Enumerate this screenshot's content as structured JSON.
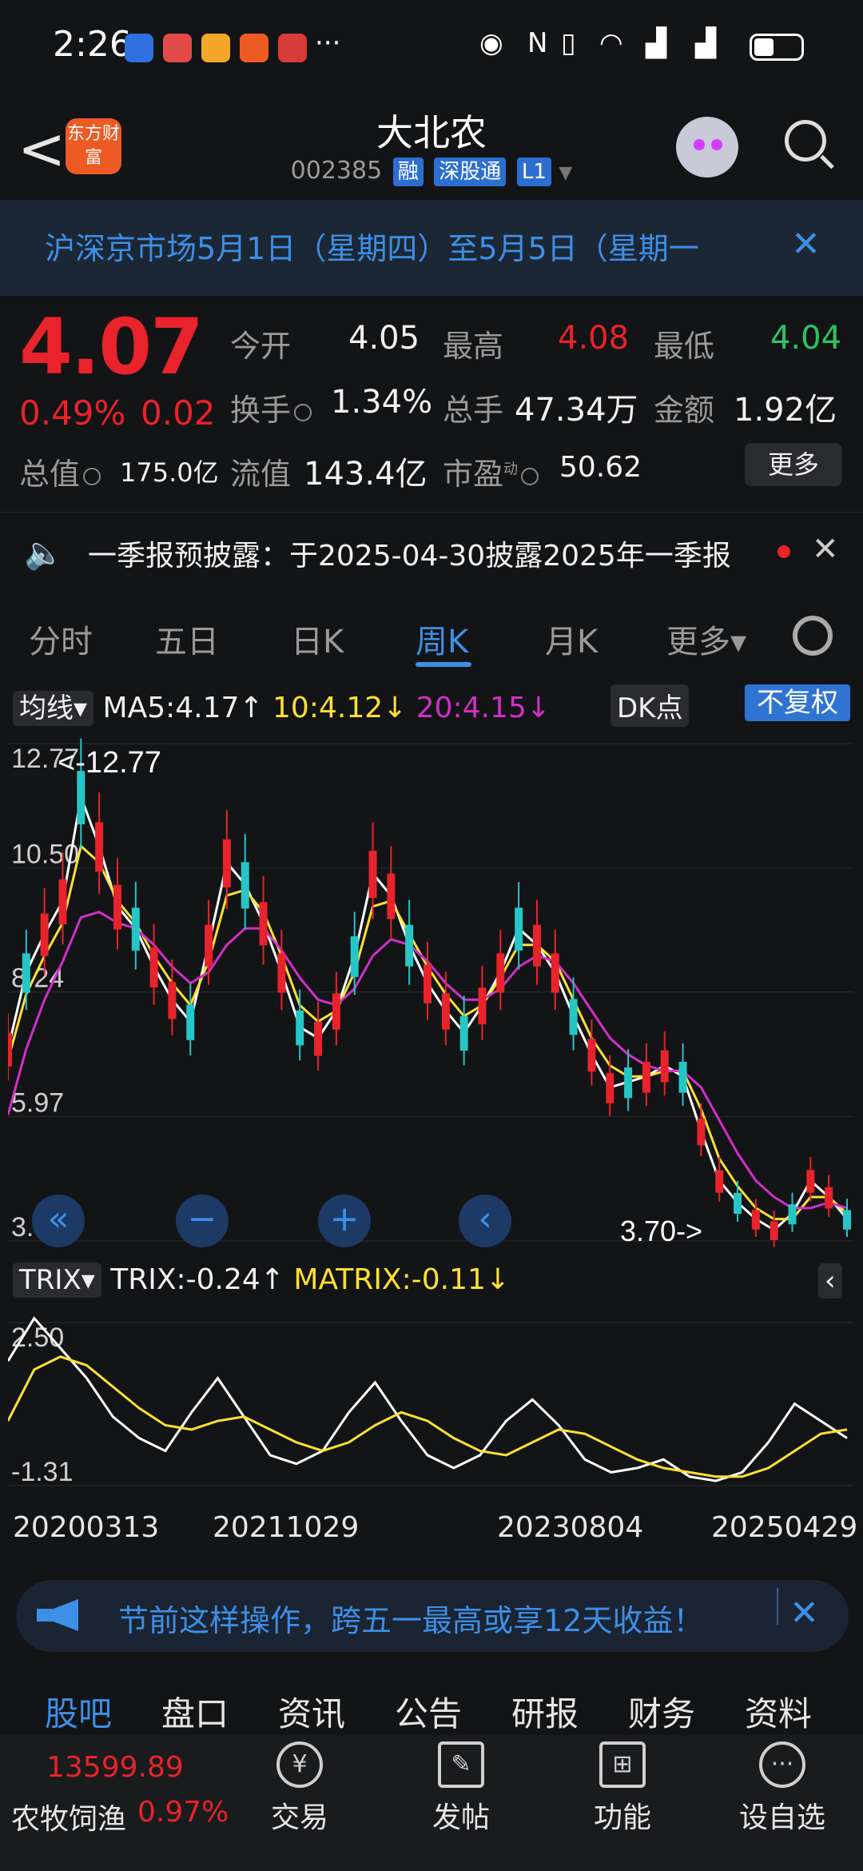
{
  "status_bar": {
    "time": "2:26",
    "dots": "···"
  },
  "header": {
    "back": "<",
    "logo_text": "东方财富",
    "title": "大北农",
    "code": "002385",
    "tags": [
      "融",
      "深股通",
      "L1"
    ]
  },
  "notice": {
    "text": "沪深京市场5月1日（星期四）至5月5日（星期一",
    "close": "✕"
  },
  "quote": {
    "price": "4.07",
    "change_pct": "0.49%",
    "change_amt": "0.02",
    "rows": [
      [
        {
          "label": "今开",
          "value": "4.05",
          "color": "#f1f1f1"
        },
        {
          "label": "最高",
          "value": "4.08",
          "color": "#e8232b"
        },
        {
          "label": "最低",
          "value": "4.04",
          "color": "#2bc465"
        }
      ],
      [
        {
          "label": "换手",
          "value": "1.34%",
          "color": "#f1f1f1"
        },
        {
          "label": "总手",
          "value": "47.34万",
          "color": "#f1f1f1"
        },
        {
          "label": "金额",
          "value": "1.92亿",
          "color": "#f1f1f1"
        }
      ]
    ],
    "total_value_label": "总值",
    "total_value": "175.0亿",
    "float_value_label": "流值",
    "float_value": "143.4亿",
    "pe_label": "市盈",
    "pe_sup": "动",
    "pe_value": "50.62",
    "more": "更多"
  },
  "report": {
    "text": "一季报预披露：于2025-04-30披露2025年一季报",
    "close": "✕"
  },
  "period_tabs": [
    "分时",
    "五日",
    "日K",
    "周K",
    "月K",
    "更多▾"
  ],
  "active_period": "周K",
  "chart_header": {
    "indicator": "均线▾",
    "ma5": "MA5:4.17↑",
    "ma10": "10:4.12↓",
    "ma20": "20:4.15↓",
    "dk": "DK点",
    "fq": "不复权"
  },
  "trix_header": {
    "indicator": "TRIX▾",
    "trix": "TRIX:-0.24↑",
    "matrix": "MATRIX:-0.11↓"
  },
  "chart_data": [
    {
      "type": "line",
      "title": "",
      "y_ticks": [
        "12.77",
        "10.50",
        "8.24",
        "5.97",
        "3.70"
      ],
      "ylim": [
        3.7,
        12.77
      ],
      "max_label": "<-12.77",
      "min_label": "3.70->",
      "series": [
        {
          "name": "MA5",
          "color": "#ffffff",
          "values": [
            7.2,
            8.6,
            9.3,
            9.9,
            11.8,
            10.9,
            9.8,
            9.4,
            8.7,
            8.1,
            7.7,
            9.1,
            10.6,
            10.2,
            9.5,
            8.6,
            7.6,
            7.4,
            7.9,
            8.9,
            10.4,
            10.0,
            9.1,
            8.4,
            7.9,
            7.5,
            8.0,
            8.6,
            9.4,
            9.1,
            8.6,
            7.8,
            7.1,
            6.5,
            6.6,
            6.7,
            6.9,
            6.7,
            5.7,
            4.8,
            4.4,
            4.1,
            3.9,
            4.2,
            4.8,
            4.5,
            4.1
          ]
        },
        {
          "name": "MA10",
          "color": "#ffe033",
          "values": [
            7.0,
            8.2,
            8.9,
            9.5,
            10.9,
            10.6,
            9.9,
            9.5,
            8.9,
            8.4,
            8.0,
            8.8,
            10.0,
            10.1,
            9.7,
            8.9,
            8.0,
            7.7,
            7.9,
            8.6,
            9.8,
            9.9,
            9.3,
            8.7,
            8.2,
            7.8,
            8.0,
            8.5,
            9.1,
            9.1,
            8.8,
            8.1,
            7.4,
            6.9,
            6.7,
            6.7,
            6.8,
            6.8,
            6.1,
            5.2,
            4.7,
            4.3,
            4.1,
            4.1,
            4.5,
            4.5,
            4.2
          ]
        },
        {
          "name": "MA20",
          "color": "#d030c8",
          "values": [
            6.0,
            7.2,
            8.1,
            8.8,
            9.6,
            9.7,
            9.5,
            9.4,
            9.1,
            8.7,
            8.4,
            8.6,
            9.1,
            9.4,
            9.4,
            9.0,
            8.5,
            8.1,
            8.0,
            8.3,
            8.9,
            9.2,
            9.1,
            8.8,
            8.4,
            8.1,
            8.1,
            8.3,
            8.7,
            8.9,
            8.8,
            8.4,
            7.9,
            7.4,
            7.1,
            6.9,
            6.8,
            6.8,
            6.5,
            5.9,
            5.3,
            4.8,
            4.5,
            4.3,
            4.3,
            4.4,
            4.3
          ]
        }
      ]
    },
    {
      "type": "line",
      "title": "",
      "y_ticks": [
        "2.50",
        "-1.31"
      ],
      "ylim": [
        -1.31,
        2.5
      ],
      "x_ticks": [
        "20200313",
        "20211029",
        "20230804",
        "20250429"
      ],
      "series": [
        {
          "name": "TRIX",
          "color": "#ffffff",
          "values": [
            1.6,
            2.6,
            1.9,
            1.2,
            0.3,
            -0.2,
            -0.5,
            0.4,
            1.2,
            0.3,
            -0.6,
            -0.8,
            -0.5,
            0.4,
            1.1,
            0.2,
            -0.6,
            -0.9,
            -0.6,
            0.2,
            0.7,
            0.1,
            -0.7,
            -1.0,
            -0.9,
            -0.7,
            -1.1,
            -1.2,
            -1.0,
            -0.3,
            0.6,
            0.2,
            -0.2
          ]
        },
        {
          "name": "MATRIX",
          "color": "#ffe033",
          "values": [
            0.2,
            1.4,
            1.7,
            1.5,
            1.0,
            0.5,
            0.1,
            0.0,
            0.2,
            0.3,
            0.0,
            -0.3,
            -0.5,
            -0.3,
            0.1,
            0.4,
            0.2,
            -0.2,
            -0.5,
            -0.6,
            -0.3,
            0.0,
            -0.1,
            -0.4,
            -0.7,
            -0.9,
            -1.0,
            -1.1,
            -1.1,
            -0.9,
            -0.5,
            -0.1,
            0.0
          ]
        }
      ]
    }
  ],
  "zoom_controls": [
    "«",
    "−",
    "+",
    "‹"
  ],
  "promo": {
    "text": "节前这样操作，跨五一最高或享12天收益！",
    "close": "✕"
  },
  "bottom_tabs": [
    "股吧",
    "盘口",
    "资讯",
    "公告",
    "研报",
    "财务",
    "资料"
  ],
  "active_bottom_tab": "股吧",
  "dock": {
    "index_value": "13599.89",
    "index_name": "农牧饲渔",
    "index_pct": "0.97%",
    "items": [
      "交易",
      "发帖",
      "功能",
      "设自选"
    ]
  }
}
